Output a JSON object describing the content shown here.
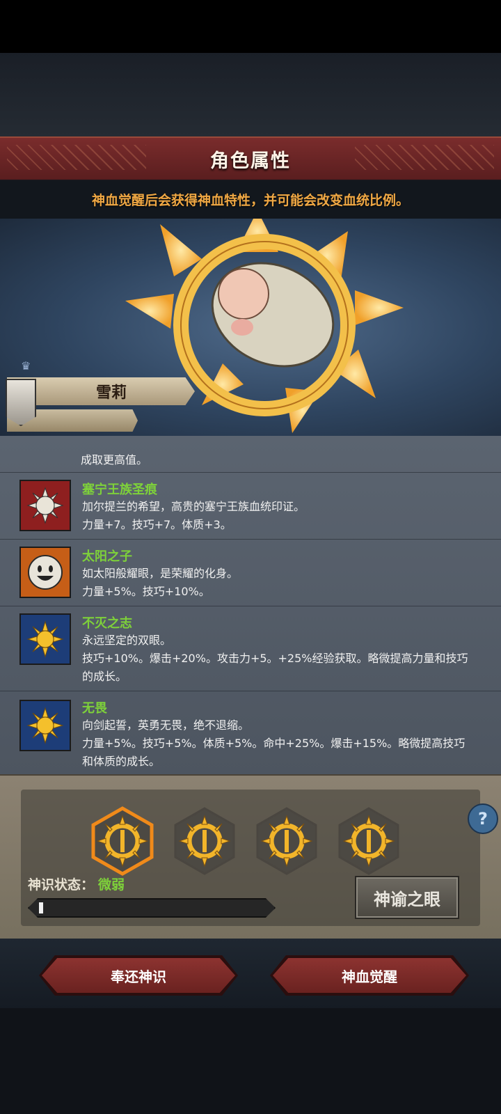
{
  "header": {
    "title": "角色属性"
  },
  "hint": "神血觉醒后会获得神血特性，并可能会改变血统比例。",
  "character": {
    "name": "雪莉"
  },
  "traits_list": {
    "cutoff_text": "成取更高值。",
    "items": [
      {
        "name": "塞宁王族圣痕",
        "description": "加尔提兰的希望，高贵的塞宁王族血统印证。",
        "effects": "力量+7。技巧+7。体质+3。",
        "icon": "white-sun-emblem-icon",
        "icon_bg": "#8e1f1f"
      },
      {
        "name": "太阳之子",
        "description": "如太阳般耀眼，是荣耀的化身。",
        "effects": "力量+5%。技巧+10%。",
        "icon": "smiling-sun-face-icon",
        "icon_bg": "#c65e17"
      },
      {
        "name": "不灭之志",
        "description": "永远坚定的双眼。",
        "effects": "技巧+10%。爆击+20%。攻击力+5。+25%经验获取。略微提高力量和技巧的成长。",
        "icon": "golden-sun-icon",
        "icon_bg": "#1d3d78"
      },
      {
        "name": "无畏",
        "description": "向剑起誓，英勇无畏，绝不退缩。",
        "effects": "力量+5%。技巧+5%。体质+5%。命中+25%。爆击+15%。略微提高技巧和体质的成长。",
        "icon": "golden-sun-icon",
        "icon_bg": "#1d3d78"
      }
    ]
  },
  "divine_slots": {
    "count": 4,
    "selected_index": 0,
    "icon": "sun-ring-icon"
  },
  "status": {
    "label": "神识状态：",
    "value": "微弱",
    "progress": 0.02
  },
  "oracle_button": "神谕之眼",
  "buttons": {
    "return_label": "奉还神识",
    "awaken_label": "神血觉醒"
  },
  "colors": {
    "header_red": "#6a2426",
    "hint_orange": "#f0a844",
    "trait_green": "#7ed13a",
    "selected_slot_glow": "#f08a1a"
  }
}
